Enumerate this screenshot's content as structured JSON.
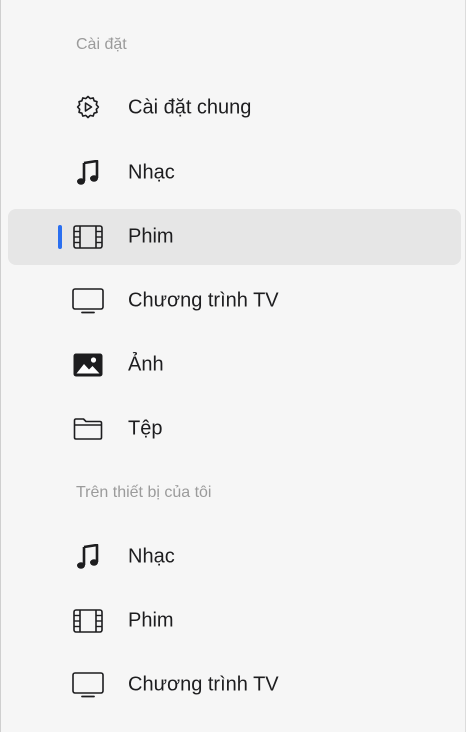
{
  "sidebar": {
    "sections": [
      {
        "header": "Cài đặt",
        "items": [
          {
            "label": "Cài đặt chung",
            "icon": "gear-icon",
            "selected": false
          },
          {
            "label": "Nhạc",
            "icon": "music-note-icon",
            "selected": false
          },
          {
            "label": "Phim",
            "icon": "film-icon",
            "selected": true
          },
          {
            "label": "Chương trình TV",
            "icon": "tv-icon",
            "selected": false
          },
          {
            "label": "Ảnh",
            "icon": "photo-icon",
            "selected": false
          },
          {
            "label": "Tệp",
            "icon": "folder-icon",
            "selected": false
          }
        ]
      },
      {
        "header": "Trên thiết bị của tôi",
        "items": [
          {
            "label": "Nhạc",
            "icon": "music-note-icon",
            "selected": false
          },
          {
            "label": "Phim",
            "icon": "film-icon",
            "selected": false
          },
          {
            "label": "Chương trình TV",
            "icon": "tv-icon",
            "selected": false
          }
        ]
      }
    ]
  },
  "colors": {
    "accent": "#2a6ff0",
    "selected_bg": "#e6e6e6",
    "header_text": "#9b9b9b"
  }
}
